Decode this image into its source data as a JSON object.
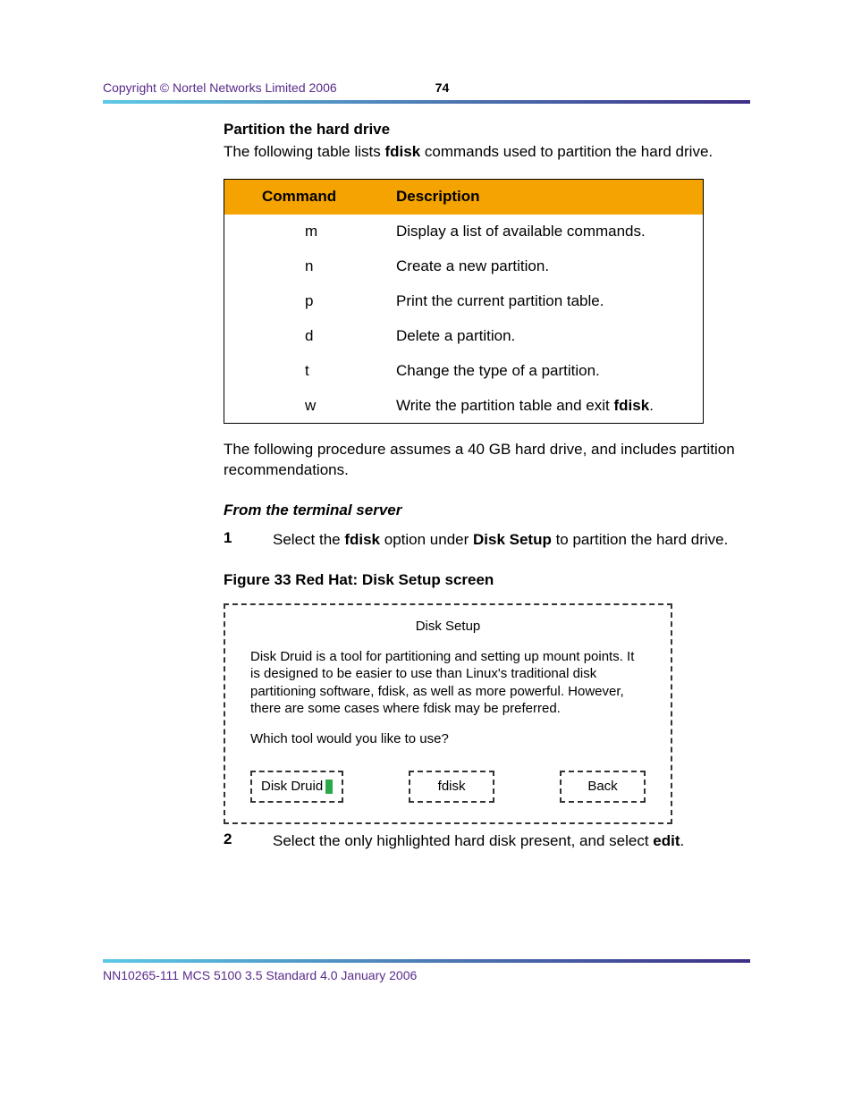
{
  "header": {
    "copyright": "Copyright © Nortel Networks Limited 2006",
    "page_number": "74"
  },
  "section": {
    "title": "Partition the hard drive",
    "intro_pre": "The following table lists ",
    "intro_bold": "fdisk",
    "intro_post": " commands used to partition the hard drive."
  },
  "table": {
    "headers": {
      "cmd": "Command",
      "desc": "Description"
    },
    "rows": [
      {
        "cmd": "m",
        "desc": "Display a list of available commands."
      },
      {
        "cmd": "n",
        "desc": "Create a new partition."
      },
      {
        "cmd": "p",
        "desc": "Print the current partition table."
      },
      {
        "cmd": "d",
        "desc": "Delete a partition."
      },
      {
        "cmd": "t",
        "desc": "Change the type of a partition."
      },
      {
        "cmd": "w",
        "desc_pre": "Write the partition table and exit ",
        "desc_bold": "fdisk",
        "desc_post": "."
      }
    ]
  },
  "assume_text": "The following procedure assumes a 40 GB hard drive, and includes partition recommendations.",
  "procedure": {
    "heading": "From the terminal server",
    "steps": [
      {
        "num": "1",
        "parts": [
          "Select the ",
          "fdisk",
          " option under ",
          "Disk Setup",
          " to partition the hard drive."
        ]
      },
      {
        "num": "2",
        "parts": [
          "Select the only highlighted hard disk present, and select ",
          "edit",
          "."
        ]
      }
    ]
  },
  "figure": {
    "caption": "Figure 33  Red Hat: Disk Setup screen",
    "title": "Disk Setup",
    "body": "Disk Druid is a tool for partitioning and setting up mount points. It is designed to be easier to use than Linux's traditional disk partitioning software, fdisk, as well as more powerful. However, there are some cases where fdisk may be preferred.",
    "question": "Which tool would you like to use?",
    "buttons": {
      "druid": "Disk Druid",
      "fdisk": "fdisk",
      "back": "Back"
    }
  },
  "footer": "NN10265-111   MCS 5100 3.5   Standard   4.0   January 2006"
}
